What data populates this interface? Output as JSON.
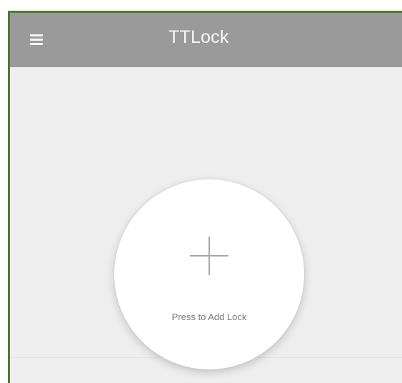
{
  "app": {
    "title": "TTLock"
  },
  "actions": {
    "add_lock_label": "Press to Add Lock"
  },
  "icons": {
    "menu": "menu-icon",
    "add": "plus-icon"
  },
  "colors": {
    "appbar": "#9a9a9a",
    "background": "#eeeeee",
    "border": "#4f7a2f"
  }
}
